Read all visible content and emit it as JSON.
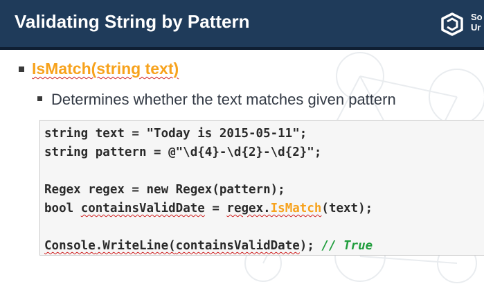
{
  "header": {
    "title": "Validating String by Pattern",
    "logo_text_line1": "So",
    "logo_text_line2": "Ur"
  },
  "bullet1": {
    "text": "IsMatch(string text)"
  },
  "bullet2": {
    "text": "Determines whether the text matches given pattern"
  },
  "code": {
    "line1": "string text = \"Today is 2015-05-11\";",
    "line2": "string pattern = @\"\\d{4}-\\d{2}-\\d{2}\";",
    "line3": "Regex regex = new Regex(pattern);",
    "line4_prefix": "bool ",
    "line4_var": "containsValidDate",
    "line4_mid": " = ",
    "line4_obj": "regex.",
    "line4_method": "IsMatch",
    "line4_suffix": "(text);",
    "line5_class": "Console",
    "line5_method": ".WriteLine(",
    "line5_arg": "containsValidDate",
    "line5_end": "); ",
    "line5_comment": "// True"
  },
  "colors": {
    "header_bg": "#1f3b5a",
    "accent": "#f7a21c",
    "comment": "#1f9d3c",
    "text": "#333a45"
  },
  "icons": {
    "logo": "softuni-logo-icon"
  }
}
